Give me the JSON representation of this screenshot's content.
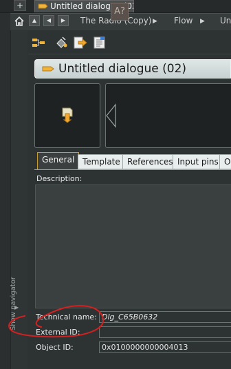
{
  "window": {
    "doc_tab_title": "Untitled dialogue (02)",
    "add_tab_label": "+"
  },
  "breadcrumb": [
    {
      "label": "The Radio (Copy)"
    },
    {
      "label": "Flow"
    },
    {
      "label": "Un"
    }
  ],
  "toolbar": {
    "help_label": "A?"
  },
  "page": {
    "title": "Untitled dialogue (02)"
  },
  "tabs": [
    {
      "label": "General",
      "active": true
    },
    {
      "label": "Template"
    },
    {
      "label": "References"
    },
    {
      "label": "Input pins"
    },
    {
      "label": "O"
    }
  ],
  "description": {
    "label": "Description:",
    "value": ""
  },
  "properties": {
    "technical_name": {
      "label": "Technical name:",
      "value": "Dlg_C65B0632"
    },
    "external_id": {
      "label": "External ID:",
      "value": ""
    },
    "object_id": {
      "label": "Object ID:",
      "value": "0x0100000000004013"
    }
  },
  "navigator": {
    "label": "Show navigator"
  },
  "colors": {
    "accent": "#e8a33a",
    "annotation": "#d42020",
    "background": "#2b2f2f"
  },
  "icons": [
    "home-icon",
    "dialogue-icon",
    "flow-icon",
    "pin-icon",
    "help-icon"
  ]
}
